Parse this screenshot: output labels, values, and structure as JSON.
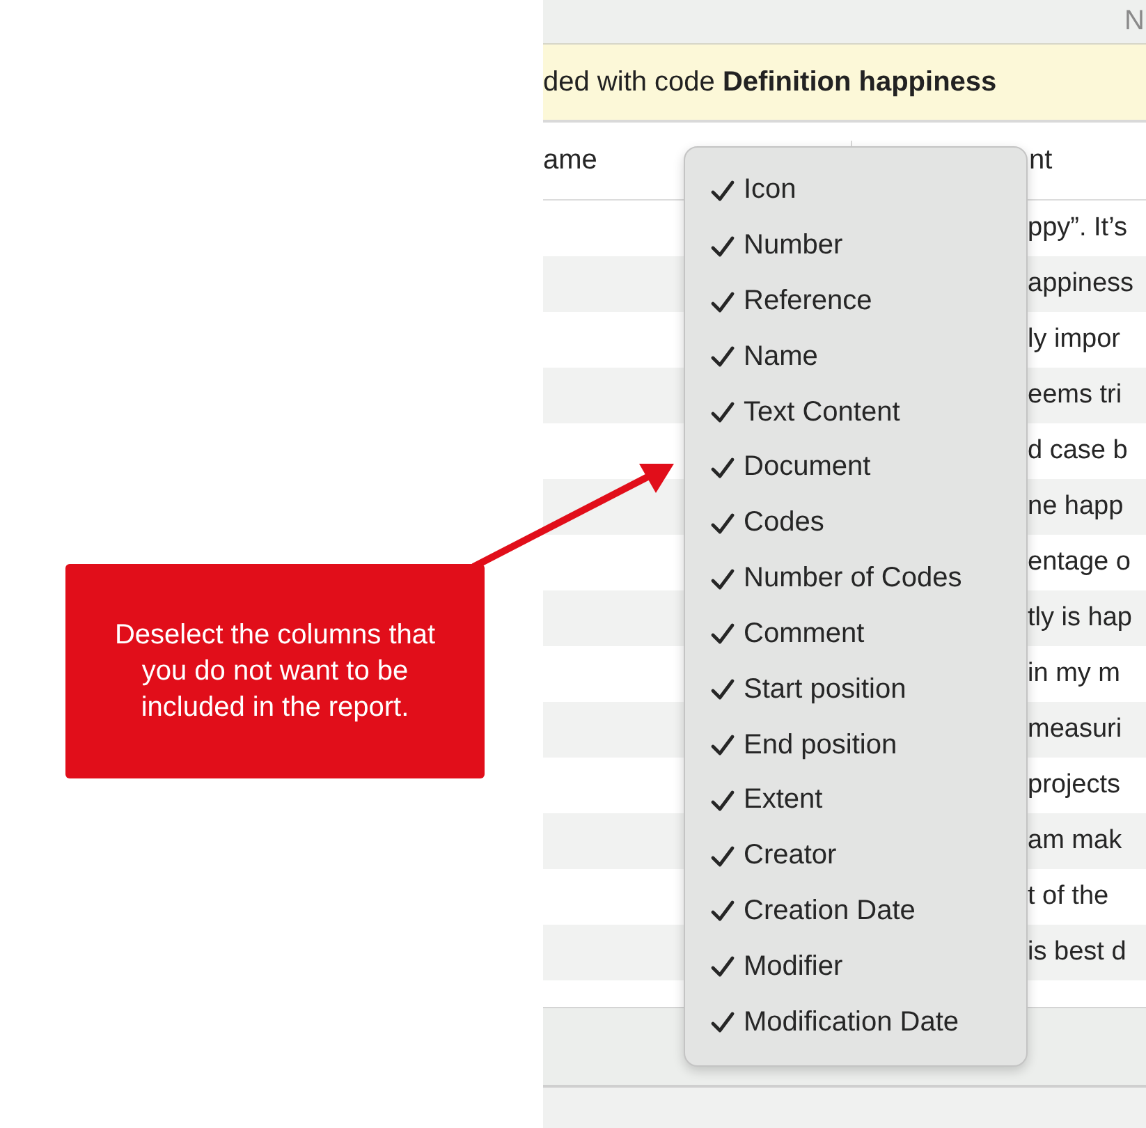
{
  "top_bar": {
    "text": "N"
  },
  "banner": {
    "text": "ded with code **Definition happiness**"
  },
  "table": {
    "columns": [
      "ame",
      "nt"
    ],
    "rows": [
      {
        "text": "ppy”. It’s"
      },
      {
        "text": "appiness"
      },
      {
        "text": "ly impor"
      },
      {
        "text": "eems tri"
      },
      {
        "text": "d case b"
      },
      {
        "text": "ne happ"
      },
      {
        "text": "entage o"
      },
      {
        "text": "tly is hap"
      },
      {
        "text": "in my m"
      },
      {
        "text": "measuri"
      },
      {
        "text": "projects"
      },
      {
        "text": "am mak"
      },
      {
        "text": "t of the"
      },
      {
        "text": "is best d"
      }
    ]
  },
  "column_menu": {
    "items": [
      {
        "label": "Icon",
        "checked": true
      },
      {
        "label": "Number",
        "checked": true
      },
      {
        "label": "Reference",
        "checked": true
      },
      {
        "label": "Name",
        "checked": true
      },
      {
        "label": "Text Content",
        "checked": true
      },
      {
        "label": "Document",
        "checked": true
      },
      {
        "label": "Codes",
        "checked": true
      },
      {
        "label": "Number of Codes",
        "checked": true
      },
      {
        "label": "Comment",
        "checked": true
      },
      {
        "label": "Start position",
        "checked": true
      },
      {
        "label": "End position",
        "checked": true
      },
      {
        "label": "Extent",
        "checked": true
      },
      {
        "label": "Creator",
        "checked": true
      },
      {
        "label": "Creation Date",
        "checked": true
      },
      {
        "label": "Modifier",
        "checked": true
      },
      {
        "label": "Modification Date",
        "checked": true
      }
    ]
  },
  "callout": {
    "text": "Deselect the columns that you do not want to be included in the report."
  }
}
